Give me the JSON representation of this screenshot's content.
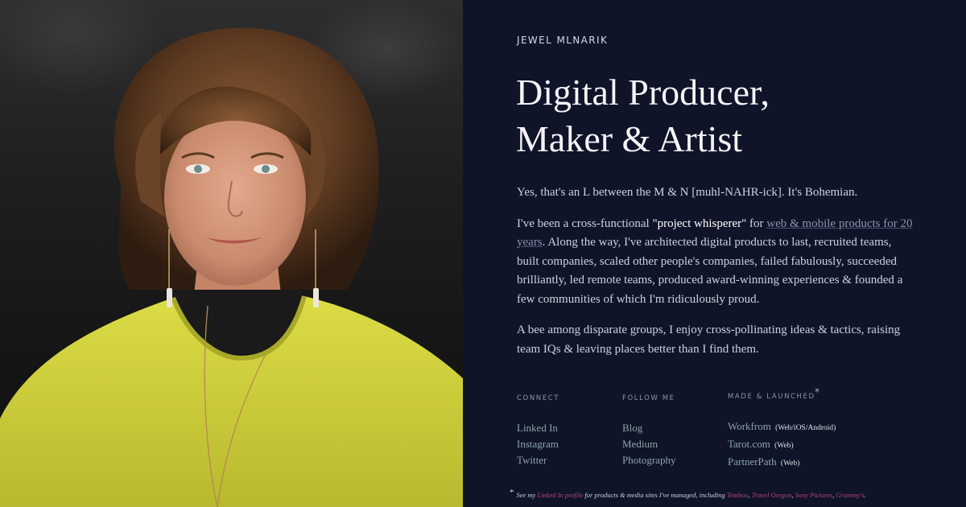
{
  "profile": {
    "name": "JEWEL MLNARIK",
    "headline_line1": "Digital Producer,",
    "headline_line2": "Maker & Artist",
    "photo_alt": "Portrait photo"
  },
  "bio": {
    "p1": "Yes, that's an L between the M & N [muhl-NAHR-ick]. It's Bohemian.",
    "p2_before": "I've been a cross-functional ",
    "p2_strong": "\"project whisperer\"",
    "p2_mid": " for ",
    "p2_link": "web & mobile products for 20 years",
    "p2_after": ". Along the way, I've architected digital products to last, recruited teams, built companies, scaled other people's companies, failed fabulously, succeeded brilliantly, led remote teams, produced award-winning experiences & founded a few communities of which I'm ridiculously proud.",
    "p3": "A bee among disparate groups, I enjoy cross-pollinating ideas & tactics, raising team IQs & leaving places better than I find them."
  },
  "connect": {
    "heading": "CONNECT",
    "links": [
      "Linked In",
      "Instagram",
      "Twitter"
    ]
  },
  "follow": {
    "heading": "FOLLOW ME",
    "links": [
      "Blog",
      "Medium",
      "Photography"
    ]
  },
  "made": {
    "heading": "MADE & LAUNCHED",
    "asterisk": "*",
    "items": [
      {
        "label": "Workfrom",
        "note": "(Web/iOS/Android)"
      },
      {
        "label": "Tarot.com",
        "note": "(Web)"
      },
      {
        "label": "PartnerPath",
        "note": "(Web)"
      }
    ]
  },
  "footnote": {
    "star": "*",
    "before": "See my ",
    "link_profile": "Linked In profile",
    "middle": " for products & media sites I've managed, including ",
    "link1": "Temboo",
    "link2": "Travel Oregon",
    "link3": "Sony Pictures",
    "link4": "Grammy's",
    "sep": ", ",
    "end": "."
  },
  "colors": {
    "panel_bg": "#0f1429",
    "link_teal": "#8ca6a6",
    "link_pink": "#c0407a",
    "sweater": "#d1d23a"
  }
}
